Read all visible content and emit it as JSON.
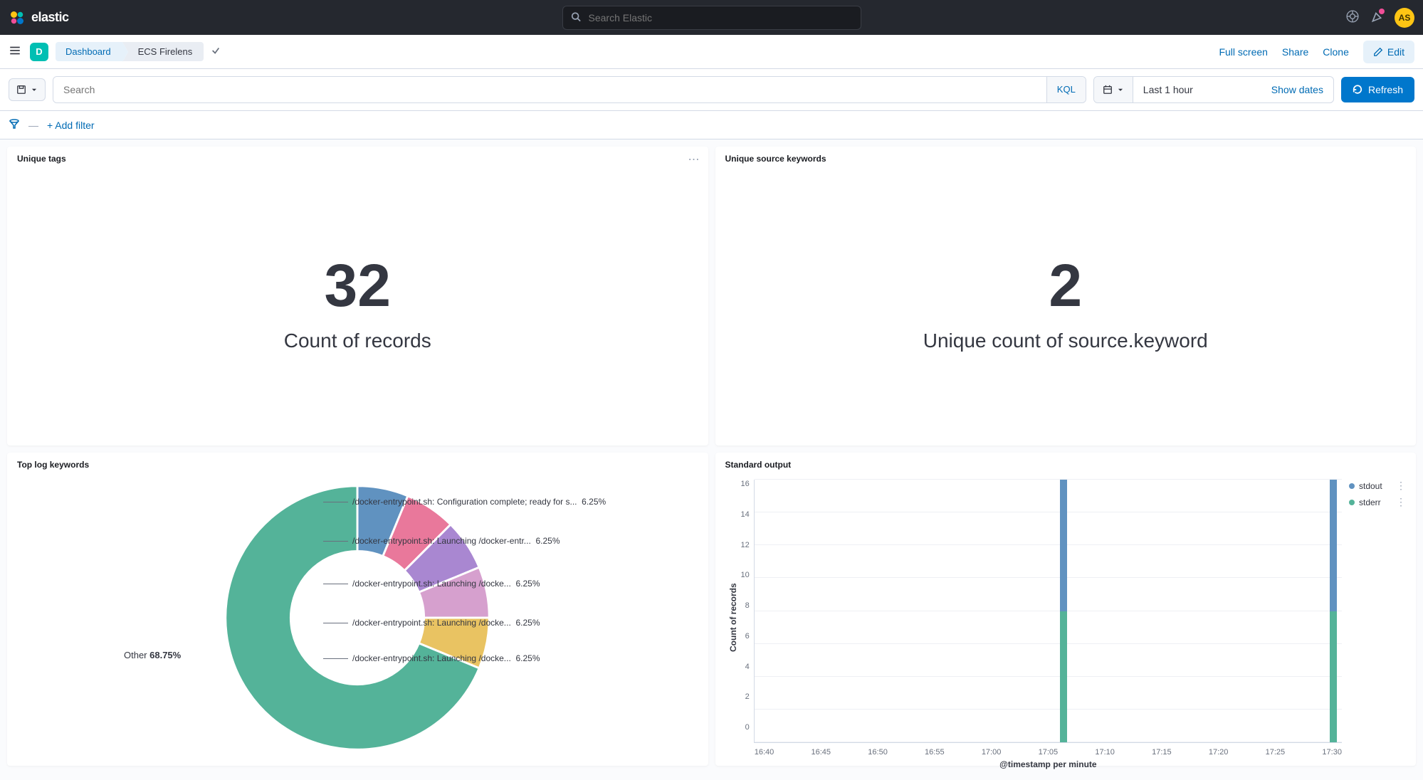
{
  "header": {
    "logo_text": "elastic",
    "search_placeholder": "Search Elastic",
    "avatar_initials": "AS"
  },
  "breadcrumb": {
    "app_badge": "D",
    "crumbs": [
      "Dashboard",
      "ECS Firelens"
    ],
    "actions": {
      "fullscreen": "Full screen",
      "share": "Share",
      "clone": "Clone",
      "edit": "Edit"
    }
  },
  "query": {
    "search_placeholder": "Search",
    "lang": "KQL",
    "time_value": "Last 1 hour",
    "show_dates": "Show dates",
    "refresh": "Refresh"
  },
  "filter": {
    "add_filter": "+ Add filter"
  },
  "panels": {
    "p1": {
      "title": "Unique tags",
      "value": "32",
      "label": "Count of records"
    },
    "p2": {
      "title": "Unique source keywords",
      "value": "2",
      "label": "Unique count of source.keyword"
    },
    "p3": {
      "title": "Top log keywords"
    },
    "p4": {
      "title": "Standard output"
    }
  },
  "chart_data": [
    {
      "type": "pie",
      "title": "Top log keywords",
      "slices": [
        {
          "label": "/docker-entrypoint.sh: Configuration complete; ready for s...",
          "pct": 6.25,
          "color": "#6092c0"
        },
        {
          "label": "/docker-entrypoint.sh: Launching /docker-entr...",
          "pct": 6.25,
          "color": "#e9789b"
        },
        {
          "label": "/docker-entrypoint.sh: Launching /docke...",
          "pct": 6.25,
          "color": "#a987d1"
        },
        {
          "label": "/docker-entrypoint.sh: Launching /docke...",
          "pct": 6.25,
          "color": "#d6a0ce"
        },
        {
          "label": "/docker-entrypoint.sh: Launching /docke...",
          "pct": 6.25,
          "color": "#e9c362"
        },
        {
          "label": "Other",
          "pct": 68.75,
          "color": "#54b399"
        }
      ]
    },
    {
      "type": "bar",
      "title": "Standard output",
      "xlabel": "@timestamp per minute",
      "ylabel": "Count of records",
      "ylim": [
        0,
        16
      ],
      "yticks": [
        0,
        2,
        4,
        6,
        8,
        10,
        12,
        14,
        16
      ],
      "categories": [
        "16:40",
        "16:45",
        "16:50",
        "16:55",
        "17:00",
        "17:05",
        "17:10",
        "17:15",
        "17:20",
        "17:25",
        "17:30"
      ],
      "series": [
        {
          "name": "stdout",
          "color": "#6092c0",
          "values": [
            0,
            0,
            0,
            0,
            0,
            0,
            8,
            0,
            0,
            0,
            0,
            8,
            0
          ]
        },
        {
          "name": "stderr",
          "color": "#54b399",
          "values": [
            0,
            0,
            0,
            0,
            0,
            0,
            8,
            0,
            0,
            0,
            0,
            8,
            0
          ]
        }
      ],
      "bars": [
        {
          "x_pct": 52,
          "stdout": 8,
          "stderr": 8
        },
        {
          "x_pct": 98,
          "stdout": 8,
          "stderr": 8
        }
      ]
    }
  ]
}
